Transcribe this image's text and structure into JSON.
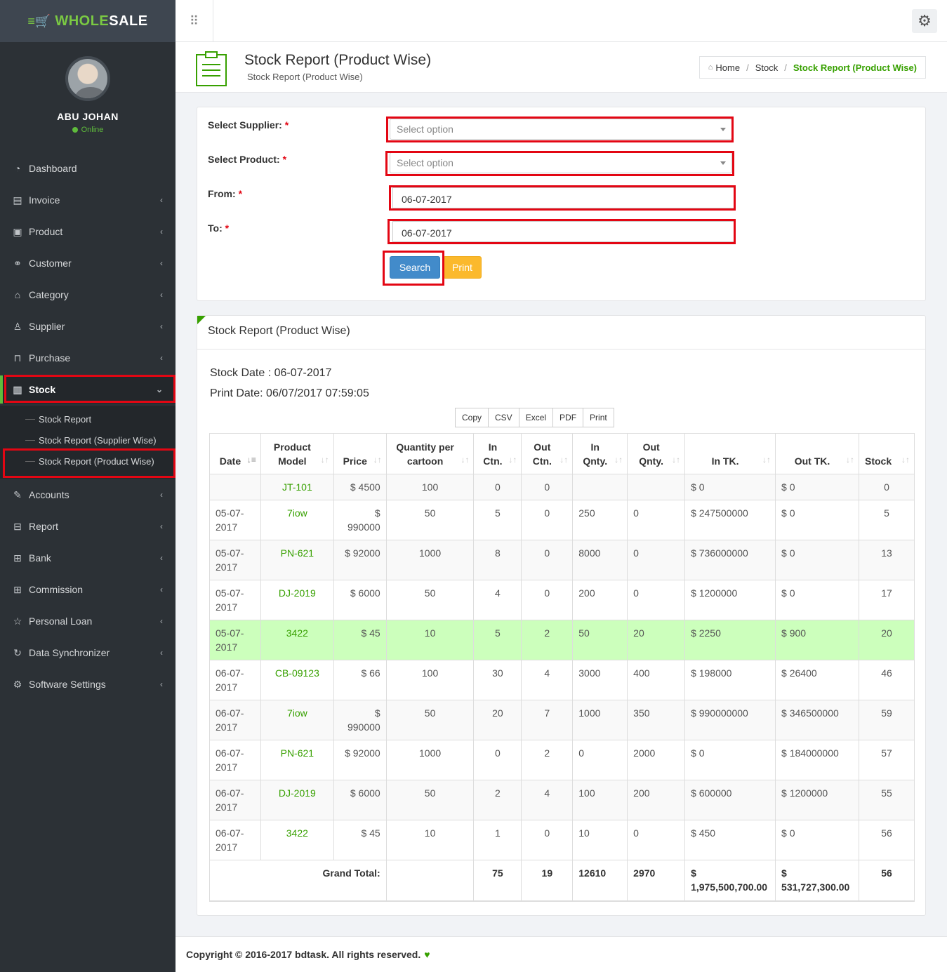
{
  "brand": {
    "name_main": "WHOLE",
    "name_accent": "SALE"
  },
  "user": {
    "name": "ABU JOHAN",
    "status": "Online"
  },
  "sidebar": {
    "items": [
      {
        "label": "Dashboard",
        "icon": "dashboard-icon"
      },
      {
        "label": "Invoice",
        "icon": "invoice-icon"
      },
      {
        "label": "Product",
        "icon": "product-icon"
      },
      {
        "label": "Customer",
        "icon": "handshake-icon"
      },
      {
        "label": "Category",
        "icon": "tag-icon"
      },
      {
        "label": "Supplier",
        "icon": "user-icon"
      },
      {
        "label": "Purchase",
        "icon": "cart-icon"
      },
      {
        "label": "Stock",
        "icon": "bar-chart-icon"
      },
      {
        "label": "Accounts",
        "icon": "edit-icon"
      },
      {
        "label": "Report",
        "icon": "book-icon"
      },
      {
        "label": "Bank",
        "icon": "bank-icon"
      },
      {
        "label": "Commission",
        "icon": "grid-icon"
      },
      {
        "label": "Personal Loan",
        "icon": "star-icon"
      },
      {
        "label": "Data Synchronizer",
        "icon": "sync-icon"
      },
      {
        "label": "Software Settings",
        "icon": "gear-icon"
      }
    ],
    "stock_submenu": [
      "Stock Report",
      "Stock Report (Supplier Wise)",
      "Stock Report (Product Wise)"
    ]
  },
  "header": {
    "title": "Stock Report (Product Wise)",
    "subtitle": "Stock Report (Product Wise)",
    "breadcrumb": [
      "Home",
      "Stock",
      "Stock Report (Product Wise)"
    ]
  },
  "form": {
    "supplier_label": "Select Supplier:",
    "product_label": "Select Product:",
    "from_label": "From:",
    "to_label": "To:",
    "required_mark": "*",
    "supplier_placeholder": "Select option",
    "product_placeholder": "Select option",
    "from_value": "06-07-2017",
    "to_value": "06-07-2017",
    "search_label": "Search",
    "print_label": "Print"
  },
  "report": {
    "title": "Stock Report (Product Wise)",
    "stock_date_label": "Stock Date :",
    "stock_date": "06-07-2017",
    "print_date_label": "Print Date:",
    "print_date": "06/07/2017 07:59:05",
    "export_buttons": [
      "Copy",
      "CSV",
      "Excel",
      "PDF",
      "Print"
    ],
    "columns": [
      "Date",
      "Product Model",
      "Price",
      "Quantity per cartoon",
      "In Ctn.",
      "Out Ctn.",
      "In Qnty.",
      "Out Qnty.",
      "In TK.",
      "Out TK.",
      "Stock"
    ],
    "rows": [
      [
        "",
        "JT-101",
        "$ 4500",
        "100",
        "0",
        "0",
        "",
        "",
        "$ 0",
        "$ 0",
        "0"
      ],
      [
        "05-07-2017",
        "7iow",
        "$ 990000",
        "50",
        "5",
        "0",
        "250",
        "0",
        "$ 247500000",
        "$ 0",
        "5"
      ],
      [
        "05-07-2017",
        "PN-621",
        "$ 92000",
        "1000",
        "8",
        "0",
        "8000",
        "0",
        "$ 736000000",
        "$ 0",
        "13"
      ],
      [
        "05-07-2017",
        "DJ-2019",
        "$ 6000",
        "50",
        "4",
        "0",
        "200",
        "0",
        "$ 1200000",
        "$ 0",
        "17"
      ],
      [
        "05-07-2017",
        "3422",
        "$ 45",
        "10",
        "5",
        "2",
        "50",
        "20",
        "$ 2250",
        "$ 900",
        "20"
      ],
      [
        "06-07-2017",
        "CB-09123",
        "$ 66",
        "100",
        "30",
        "4",
        "3000",
        "400",
        "$ 198000",
        "$ 26400",
        "46"
      ],
      [
        "06-07-2017",
        "7iow",
        "$ 990000",
        "50",
        "20",
        "7",
        "1000",
        "350",
        "$ 990000000",
        "$ 346500000",
        "59"
      ],
      [
        "06-07-2017",
        "PN-621",
        "$ 92000",
        "1000",
        "0",
        "2",
        "0",
        "2000",
        "$ 0",
        "$ 184000000",
        "57"
      ],
      [
        "06-07-2017",
        "DJ-2019",
        "$ 6000",
        "50",
        "2",
        "4",
        "100",
        "200",
        "$ 600000",
        "$ 1200000",
        "55"
      ],
      [
        "06-07-2017",
        "3422",
        "$ 45",
        "10",
        "1",
        "0",
        "10",
        "0",
        "$ 450",
        "$ 0",
        "56"
      ]
    ],
    "total": {
      "label": "Grand Total:",
      "in_ctn": "75",
      "out_ctn": "19",
      "in_qnty": "12610",
      "out_qnty": "2970",
      "in_tk": "$ 1,975,500,700.00",
      "out_tk": "$ 531,727,300.00",
      "stock": "56"
    }
  },
  "footer": {
    "text": "Copyright © 2016-2017 bdtask. All rights reserved."
  },
  "colors": {
    "accent": "#37a000",
    "sidebar": "#2c3136",
    "highlight_row": "#ccffbc",
    "annotation": "#e30613"
  }
}
